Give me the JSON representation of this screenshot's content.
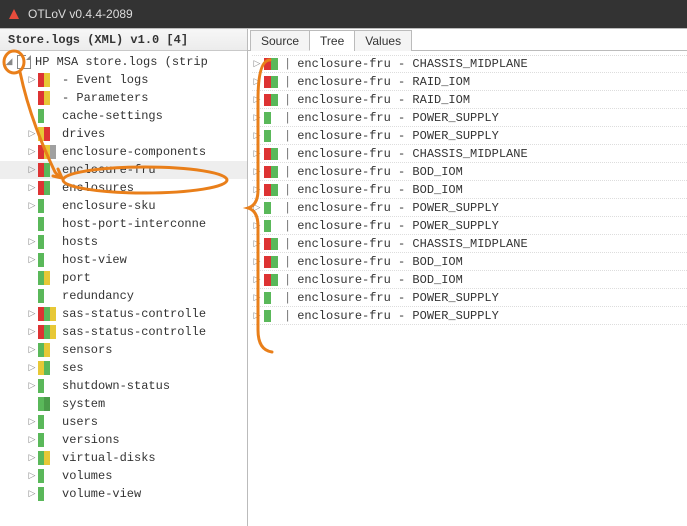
{
  "app": {
    "title": "OTLoV v0.4.4-2089"
  },
  "left": {
    "header": "Store.logs (XML) v1.0 [4]",
    "root": "HP MSA store.logs (strip",
    "items": [
      {
        "label": "- Event logs",
        "bar": "tribar-ry",
        "exp": true
      },
      {
        "label": "- Parameters",
        "bar": "tribar-ry",
        "exp": false
      },
      {
        "label": "cache-settings",
        "bar": "tribar-g",
        "exp": false
      },
      {
        "label": "drives",
        "bar": "tribar-yr",
        "exp": true
      },
      {
        "label": "enclosure-components",
        "bar": "tribar-ryl",
        "exp": true
      },
      {
        "label": "enclosure-fru",
        "bar": "tribar-rg",
        "exp": true,
        "selected": true
      },
      {
        "label": "enclosures",
        "bar": "tribar-rg",
        "exp": true
      },
      {
        "label": "enclosure-sku",
        "bar": "tribar-g",
        "exp": true
      },
      {
        "label": "host-port-interconne",
        "bar": "tribar-g",
        "exp": false
      },
      {
        "label": "hosts",
        "bar": "tribar-g",
        "exp": true
      },
      {
        "label": "host-view",
        "bar": "tribar-g",
        "exp": true
      },
      {
        "label": "port",
        "bar": "tribar-gy",
        "exp": false
      },
      {
        "label": "redundancy",
        "bar": "tribar-g",
        "exp": false
      },
      {
        "label": "sas-status-controlle",
        "bar": "tribar-rgy",
        "exp": true
      },
      {
        "label": "sas-status-controlle",
        "bar": "tribar-rgy",
        "exp": true
      },
      {
        "label": "sensors",
        "bar": "tribar-gy",
        "exp": true
      },
      {
        "label": "ses",
        "bar": "tribar-yg",
        "exp": true
      },
      {
        "label": "shutdown-status",
        "bar": "tribar-g",
        "exp": true
      },
      {
        "label": "system",
        "bar": "tribar-gg",
        "exp": false
      },
      {
        "label": "users",
        "bar": "tribar-g",
        "exp": true
      },
      {
        "label": "versions",
        "bar": "tribar-g",
        "exp": true
      },
      {
        "label": "virtual-disks",
        "bar": "tribar-gy",
        "exp": true
      },
      {
        "label": "volumes",
        "bar": "tribar-g",
        "exp": true
      },
      {
        "label": "volume-view",
        "bar": "tribar-g",
        "exp": true
      }
    ]
  },
  "tabs": [
    {
      "label": "Source",
      "active": false
    },
    {
      "label": "Tree",
      "active": true
    },
    {
      "label": "Values",
      "active": false
    }
  ],
  "right": {
    "items": [
      {
        "label": "enclosure-fru - CHASSIS_MIDPLANE",
        "bar": "rb-rg"
      },
      {
        "label": "enclosure-fru - RAID_IOM",
        "bar": "rb-rg"
      },
      {
        "label": "enclosure-fru - RAID_IOM",
        "bar": "rb-rg"
      },
      {
        "label": "enclosure-fru - POWER_SUPPLY",
        "bar": "rb-g"
      },
      {
        "label": "enclosure-fru - POWER_SUPPLY",
        "bar": "rb-g"
      },
      {
        "label": "enclosure-fru - CHASSIS_MIDPLANE",
        "bar": "rb-rg"
      },
      {
        "label": "enclosure-fru - BOD_IOM",
        "bar": "rb-rg"
      },
      {
        "label": "enclosure-fru - BOD_IOM",
        "bar": "rb-rg"
      },
      {
        "label": "enclosure-fru - POWER_SUPPLY",
        "bar": "rb-g"
      },
      {
        "label": "enclosure-fru - POWER_SUPPLY",
        "bar": "rb-g"
      },
      {
        "label": "enclosure-fru - CHASSIS_MIDPLANE",
        "bar": "rb-rg"
      },
      {
        "label": "enclosure-fru - BOD_IOM",
        "bar": "rb-rg"
      },
      {
        "label": "enclosure-fru - BOD_IOM",
        "bar": "rb-rg"
      },
      {
        "label": "enclosure-fru - POWER_SUPPLY",
        "bar": "rb-g"
      },
      {
        "label": "enclosure-fru - POWER_SUPPLY",
        "bar": "rb-g"
      }
    ]
  },
  "annotation_color": "#e97f1a"
}
